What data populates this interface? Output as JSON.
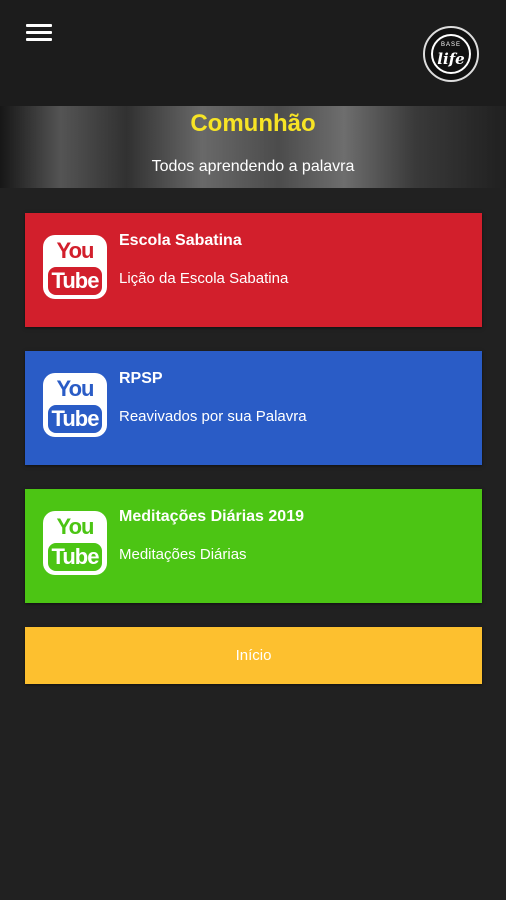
{
  "header": {
    "menu_icon": "hamburger-menu-icon",
    "logo": {
      "top_text": "BASE",
      "main_text": "life"
    }
  },
  "hero": {
    "title": "Comunhão",
    "subtitle": "Todos aprendendo a palavra",
    "title_color": "#f7e425"
  },
  "cards": [
    {
      "title": "Escola Sabatina",
      "subtitle": "Lição da Escola Sabatina",
      "color": "#d21f2c",
      "icon": "youtube-icon",
      "icon_top": "You",
      "icon_bottom": "Tube"
    },
    {
      "title": "RPSP",
      "subtitle": "Reavivados por sua Palavra",
      "color": "#2a5cc6",
      "icon": "youtube-icon",
      "icon_top": "You",
      "icon_bottom": "Tube"
    },
    {
      "title": "Meditações Diárias 2019",
      "subtitle": "Meditações Diárias",
      "color": "#4cc514",
      "icon": "youtube-icon",
      "icon_top": "You",
      "icon_bottom": "Tube"
    }
  ],
  "start_button": {
    "label": "Início",
    "color": "#fdc02f"
  }
}
